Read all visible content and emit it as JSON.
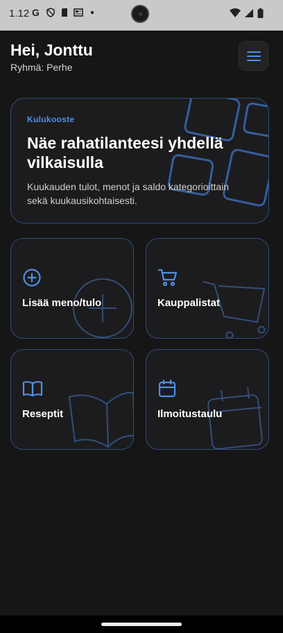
{
  "status_bar": {
    "time": "1.12",
    "left_icons": [
      "google-icon",
      "shield-icon",
      "sd-card-icon",
      "news-icon",
      "dot-icon"
    ],
    "right_icons": [
      "wifi-icon",
      "signal-icon",
      "battery-icon"
    ]
  },
  "header": {
    "greeting": "Hei, Jonttu",
    "group": "Ryhmä: Perhe",
    "menu_icon": "hamburger-menu-icon"
  },
  "hero": {
    "eyebrow": "Kulukooste",
    "title": "Näe rahatilanteesi yhdellä vilkaisulla",
    "description": "Kuukauden tulot, menot ja saldo kategorioittain sekä kuukausikohtaisesti."
  },
  "tiles": [
    {
      "label": "Lisää meno/tulo",
      "icon": "plus-circle-icon"
    },
    {
      "label": "Kauppalistat",
      "icon": "shopping-cart-icon"
    },
    {
      "label": "Reseptit",
      "icon": "book-open-icon"
    },
    {
      "label": "Ilmoitustaulu",
      "icon": "calendar-icon"
    }
  ],
  "colors": {
    "accent": "#4f8fe8",
    "card_border": "#2e4d7e",
    "card_bg": "#1c1c1e",
    "background": "#161616"
  }
}
